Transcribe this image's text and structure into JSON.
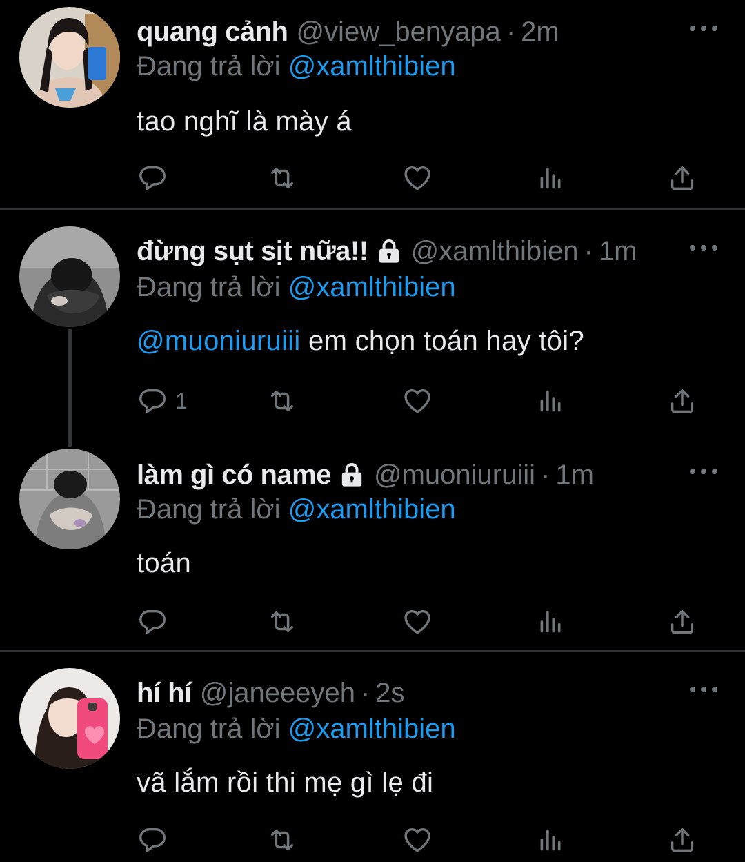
{
  "colors": {
    "background": "#000000",
    "text": "#e7e9ea",
    "muted": "#71767b",
    "accent": "#1d9bf0",
    "divider": "#2f3336"
  },
  "tweets": [
    {
      "display_name": "quang cảnh",
      "handle": "@view_benyapa",
      "separator": "·",
      "time": "2m",
      "reply_prefix": "Đang trả lời",
      "reply_to": "@xamlthibien",
      "text_mention": "",
      "text": "tao nghĩ là mày á",
      "reply_count": "",
      "locked": false
    },
    {
      "display_name": "đừng sụt sịt nữa!!",
      "handle": "@xamlthibien",
      "separator": "·",
      "time": "1m",
      "reply_prefix": "Đang trả lời",
      "reply_to": "@xamlthibien",
      "text_mention": "@muoniuruiii",
      "text": " em chọn toán hay tôi?",
      "reply_count": "1",
      "locked": true
    },
    {
      "display_name": "làm gì có name",
      "handle": "@muoniuruiii",
      "separator": "·",
      "time": "1m",
      "reply_prefix": "Đang trả lời",
      "reply_to": "@xamlthibien",
      "text_mention": "",
      "text": "toán",
      "reply_count": "",
      "locked": true
    },
    {
      "display_name": "hí hí",
      "handle": "@janeeeyeh",
      "separator": "·",
      "time": "2s",
      "reply_prefix": "Đang trả lời",
      "reply_to": "@xamlthibien",
      "text_mention": "",
      "text": "vã lắm rồi thi mẹ gì lẹ đi",
      "reply_count": "",
      "locked": false
    }
  ]
}
